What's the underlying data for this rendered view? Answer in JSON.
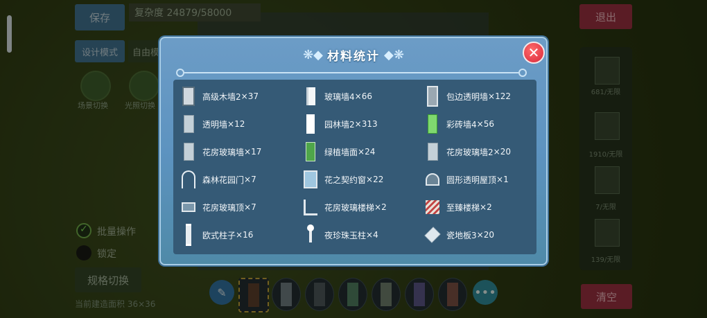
{
  "background": {
    "save_label": "保存",
    "complexity": "复杂度 24879/58000",
    "mode_label": "设计模式",
    "mode_value": "自由模",
    "thumb_left_label": "场景切换",
    "thumb_right_label": "光照切换",
    "exit_label": "退出",
    "batch_label": "批量操作",
    "lock_label": "锁定",
    "spec_switch_label": "规格切换",
    "build_area": "当前建造面积 36×36",
    "clear_label": "清空",
    "right_panel": [
      {
        "label": "681/无限"
      },
      {
        "label": "1910/无限"
      },
      {
        "label": "7/无限"
      },
      {
        "label": "139/无限"
      }
    ],
    "more_label": "•••"
  },
  "modal": {
    "title": "材料统计",
    "close_label": "✕",
    "items": [
      {
        "name": "高级木墙2",
        "count": "×37",
        "icon": "wood-wall-icon"
      },
      {
        "name": "玻璃墙4",
        "count": "×66",
        "icon": "glass-wall-icon"
      },
      {
        "name": "包边透明墙",
        "count": "×122",
        "icon": "framed-glass-wall-icon"
      },
      {
        "name": "透明墙",
        "count": "×12",
        "icon": "clear-wall-icon"
      },
      {
        "name": "园林墙2",
        "count": "×313",
        "icon": "garden-wall-icon"
      },
      {
        "name": "彩砖墙4",
        "count": "×56",
        "icon": "colored-brick-wall-icon"
      },
      {
        "name": "花房玻璃墙",
        "count": "×17",
        "icon": "greenhouse-glass-wall-icon"
      },
      {
        "name": "绿植墙面",
        "count": "×24",
        "icon": "green-plant-wall-icon"
      },
      {
        "name": "花房玻璃墙2",
        "count": "×20",
        "icon": "greenhouse-glass-wall-2-icon"
      },
      {
        "name": "森林花园门",
        "count": "×7",
        "icon": "forest-garden-door-icon"
      },
      {
        "name": "花之契约窗",
        "count": "×22",
        "icon": "flower-window-icon"
      },
      {
        "name": "圆形透明屋顶",
        "count": "×1",
        "icon": "round-clear-roof-icon"
      },
      {
        "name": "花房玻璃顶",
        "count": "×7",
        "icon": "greenhouse-glass-roof-icon"
      },
      {
        "name": "花房玻璃楼梯",
        "count": "×2",
        "icon": "greenhouse-glass-stairs-icon"
      },
      {
        "name": "至臻楼梯",
        "count": "×2",
        "icon": "supreme-stairs-icon"
      },
      {
        "name": "欧式柱子",
        "count": "×16",
        "icon": "european-pillar-icon"
      },
      {
        "name": "夜珍珠玉柱",
        "count": "×4",
        "icon": "night-pearl-pillar-icon"
      },
      {
        "name": "瓷地板3",
        "count": "×20",
        "icon": "porcelain-floor-icon"
      }
    ]
  }
}
